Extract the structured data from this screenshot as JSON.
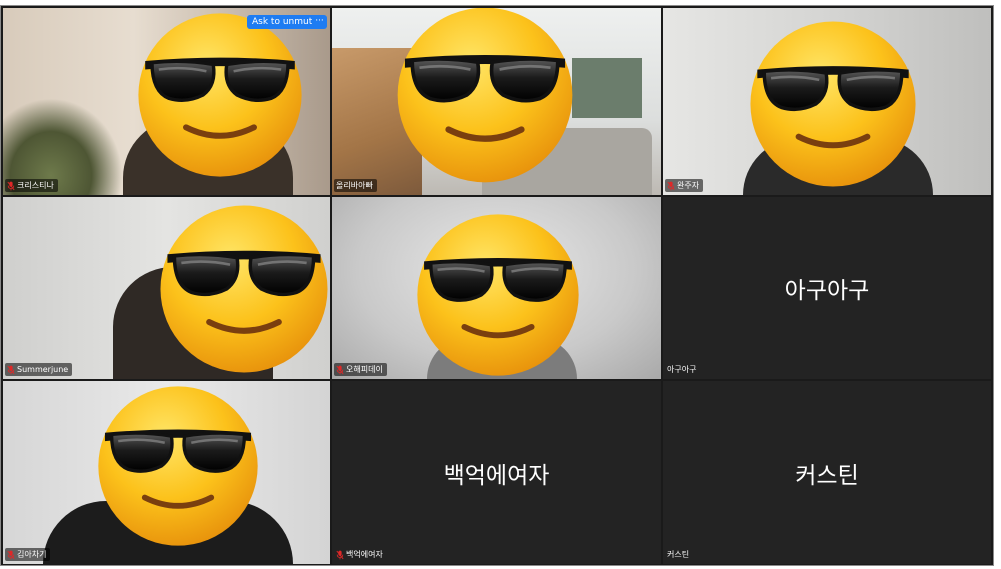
{
  "meeting": {
    "ask_to_unmute_label": "Ask to unmute",
    "more_label": "···",
    "participants": [
      {
        "name": "크리스티나",
        "video": true,
        "muted": true
      },
      {
        "name": "올리바아빠",
        "video": true,
        "muted": false,
        "active_speaker": true
      },
      {
        "name": "완주자",
        "video": true,
        "muted": true
      },
      {
        "name": "Summerjune",
        "video": true,
        "muted": true
      },
      {
        "name": "오해피데이",
        "video": true,
        "muted": true
      },
      {
        "name": "아구아구",
        "video": false,
        "muted": false,
        "display_name": "아구아구"
      },
      {
        "name": "김아차기",
        "video": true,
        "muted": true
      },
      {
        "name": "백억에여자",
        "video": false,
        "muted": true,
        "display_name": "백억에여자"
      },
      {
        "name": "커스틴",
        "video": false,
        "muted": false,
        "display_name": "커스틴"
      }
    ]
  },
  "colors": {
    "active_speaker_border": "#2fa84a",
    "muted_icon": "#e02828",
    "button_blue": "#1e7cf2",
    "tile_dark": "#232323"
  },
  "icons": {
    "muted": "mic-muted-icon",
    "emoji": "sunglasses-emoji-icon"
  }
}
